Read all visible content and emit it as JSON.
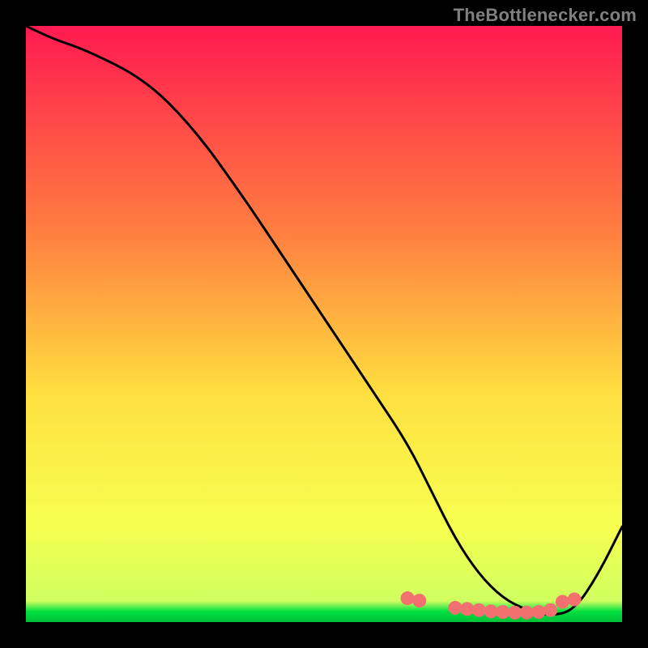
{
  "attribution": "TheBottlenecker.com",
  "colors": {
    "top": "#ff1a50",
    "mid_upper": "#ff8040",
    "mid": "#ffe040",
    "mid_lower": "#f6ff50",
    "green": "#00e040",
    "curve": "#000000",
    "marker": "#f27070"
  },
  "chart_data": {
    "type": "line",
    "title": "",
    "xlabel": "",
    "ylabel": "",
    "xlim": [
      0,
      100
    ],
    "ylim": [
      0,
      100
    ],
    "series": [
      {
        "name": "curve",
        "x": [
          0,
          4,
          10,
          20,
          28,
          36,
          44,
          52,
          58,
          64,
          68,
          72,
          76,
          80,
          84,
          88,
          92,
          96,
          100
        ],
        "y": [
          100,
          98,
          96,
          91,
          83,
          72,
          60,
          48,
          39,
          30,
          22,
          14,
          8,
          4,
          2,
          1,
          2,
          8,
          16
        ]
      }
    ],
    "markers": {
      "name": "highlight-points",
      "x": [
        64,
        66,
        72,
        74,
        76,
        78,
        80,
        82,
        84,
        86,
        88,
        90,
        92
      ],
      "y": [
        4.0,
        3.6,
        2.4,
        2.2,
        2.0,
        1.8,
        1.7,
        1.6,
        1.6,
        1.7,
        2.0,
        3.4,
        3.8
      ]
    }
  }
}
